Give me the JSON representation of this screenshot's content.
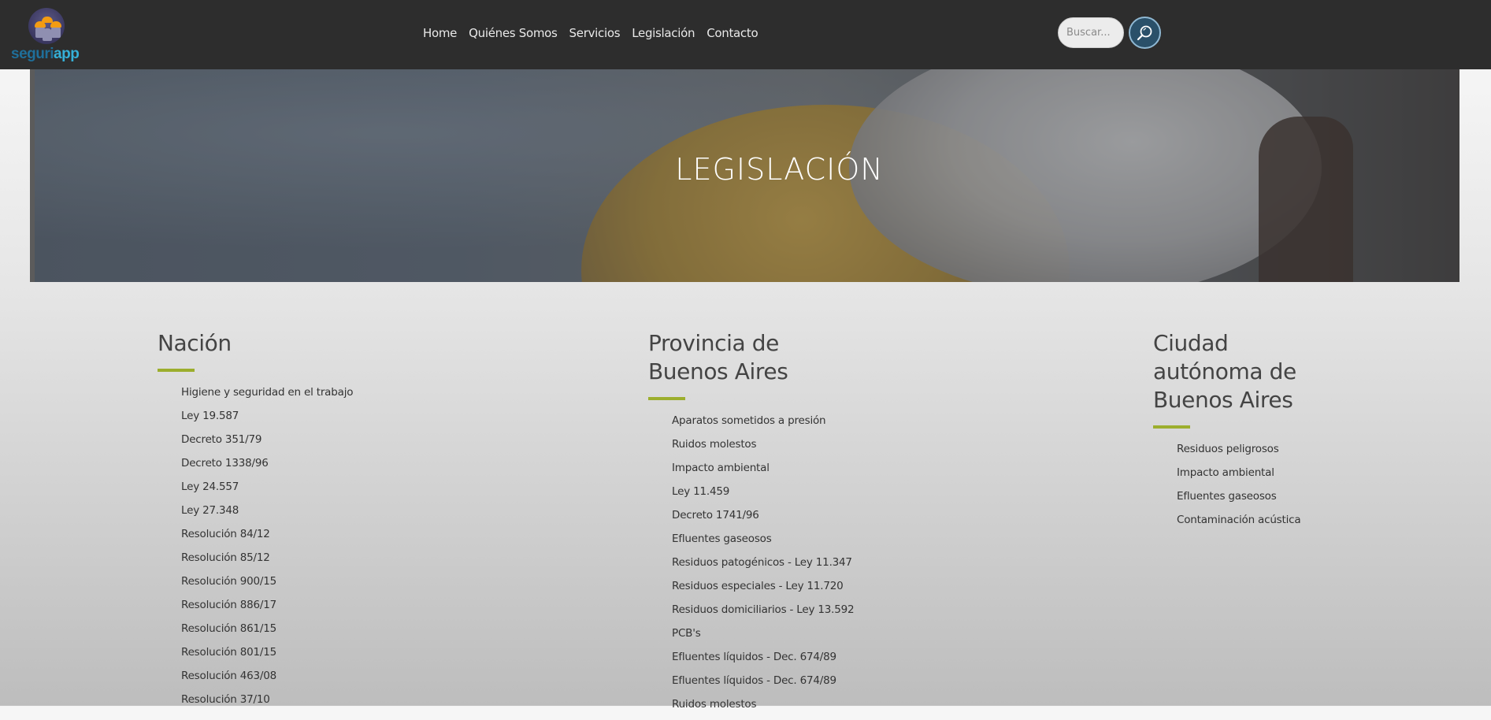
{
  "brand": {
    "logo_text_a": "seguri",
    "logo_text_b": "app"
  },
  "nav": {
    "items": [
      "Home",
      "Quiénes Somos",
      "Servicios",
      "Legislación",
      "Contacto"
    ]
  },
  "search": {
    "placeholder": "Buscar..."
  },
  "hero": {
    "title": "LEGISLACIÓN"
  },
  "sections": {
    "nacion": {
      "title": "Nación",
      "items": [
        "Higiene y seguridad en el trabajo",
        "Ley 19.587",
        "Decreto 351/79",
        "Decreto 1338/96",
        "Ley 24.557",
        "Ley 27.348",
        "Resolución 84/12",
        "Resolución 85/12",
        "Resolución 900/15",
        "Resolución 886/17",
        "Resolución 861/15",
        "Resolución 801/15",
        "Resolución 463/08",
        "Resolución 37/10"
      ]
    },
    "provincia": {
      "title_line1": "Provincia de",
      "title_line2": "Buenos Aires",
      "items": [
        "Aparatos sometidos a presión",
        "Ruidos molestos",
        "Impacto ambiental",
        "Ley 11.459",
        "Decreto 1741/96",
        "Efluentes gaseosos",
        "Residuos patogénicos - Ley 11.347",
        "Residuos especiales - Ley 11.720",
        "Residuos domiciliarios - Ley 13.592",
        "PCB's",
        "Efluentes líquidos - Dec. 674/89",
        "Efluentes líquidos - Dec. 674/89",
        "Ruidos molestos"
      ]
    },
    "caba": {
      "title_line1": "Ciudad",
      "title_line2": "autónoma de",
      "title_line3": "Buenos Aires",
      "items": [
        "Residuos peligrosos",
        "Impacto ambiental",
        "Efluentes gaseosos",
        "Contaminación acústica"
      ]
    }
  },
  "colors": {
    "header_bg": "#2d2d2d",
    "accent_rule": "#9cae2d",
    "search_button": "#2a5069"
  },
  "icons": {
    "search_button": "search-icon"
  }
}
